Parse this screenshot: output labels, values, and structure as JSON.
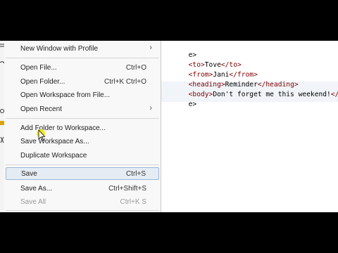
{
  "menu": {
    "items": [
      {
        "label": "New Window with Profile",
        "shortcut": "",
        "submenu": true
      },
      {
        "label": "Open File...",
        "shortcut": "Ctrl+O"
      },
      {
        "label": "Open Folder...",
        "shortcut": "Ctrl+K Ctrl+O"
      },
      {
        "label": "Open Workspace from File...",
        "shortcut": ""
      },
      {
        "label": "Open Recent",
        "shortcut": "",
        "submenu": true
      },
      {
        "label": "Add Folder to Workspace...",
        "shortcut": ""
      },
      {
        "label": "Save Workspace As...",
        "shortcut": ""
      },
      {
        "label": "Duplicate Workspace",
        "shortcut": ""
      },
      {
        "label": "Save",
        "shortcut": "Ctrl+S",
        "selected": true
      },
      {
        "label": "Save As...",
        "shortcut": "Ctrl+Shift+S"
      },
      {
        "label": "Save All",
        "shortcut": "Ctrl+K S",
        "disabled": true
      }
    ],
    "submenu_glyph": "›"
  },
  "editor": {
    "lines": [
      {
        "open": "",
        "text": "e>",
        "close": ""
      },
      {
        "open": "<to>",
        "text": "Tove",
        "close": "</to>"
      },
      {
        "open": "<from>",
        "text": "Jani",
        "close": "</from>"
      },
      {
        "open": "<heading>",
        "text": "Reminder",
        "close": "</heading>"
      },
      {
        "open": "<body>",
        "text": "Don't forget me this weekend!",
        "close": "</body"
      },
      {
        "open": "",
        "text": "e>",
        "close": ""
      }
    ]
  },
  "colors": {
    "tag": "#800000",
    "selection_bg": "#e6ecf4",
    "selection_border": "#9bb6d8",
    "letterbox": "#000000"
  },
  "icons": {
    "cursor": "mouse-pointer-icon"
  }
}
